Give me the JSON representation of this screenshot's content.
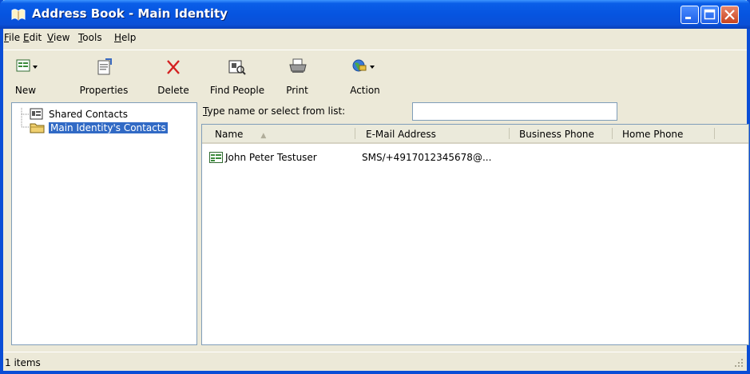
{
  "window": {
    "title": "Address Book - Main Identity",
    "icon": "address-book-icon"
  },
  "menu": [
    {
      "label": "File",
      "accel": "F",
      "rest": "ile"
    },
    {
      "label": "Edit",
      "accel": "E",
      "rest": "dit"
    },
    {
      "label": "View",
      "accel": "V",
      "rest": "iew"
    },
    {
      "label": "Tools",
      "accel": "T",
      "rest": "ools"
    },
    {
      "label": "Help",
      "accel": "H",
      "rest": "elp"
    }
  ],
  "toolbar": {
    "new": "New",
    "properties": "Properties",
    "delete": "Delete",
    "find_people": "Find People",
    "print": "Print",
    "action": "Action"
  },
  "tree": {
    "items": [
      {
        "label": "Shared Contacts",
        "icon": "contacts-book-icon",
        "selected": false
      },
      {
        "label": "Main Identity's Contacts",
        "icon": "folder-icon",
        "selected": true
      }
    ]
  },
  "search": {
    "label_accel": "T",
    "label_rest": "ype name or select from list:",
    "value": ""
  },
  "list": {
    "columns": [
      "Name",
      "E-Mail Address",
      "Business Phone",
      "Home Phone"
    ],
    "sort_indicator": "▲",
    "rows": [
      {
        "name": "John Peter Testuser",
        "email": "SMS/+4917012345678@...",
        "business_phone": "",
        "home_phone": ""
      }
    ]
  },
  "status": {
    "text": "1 items"
  },
  "colors": {
    "titlebar": "#0a5ee8",
    "face": "#ece9d8",
    "selection": "#316ac5"
  }
}
